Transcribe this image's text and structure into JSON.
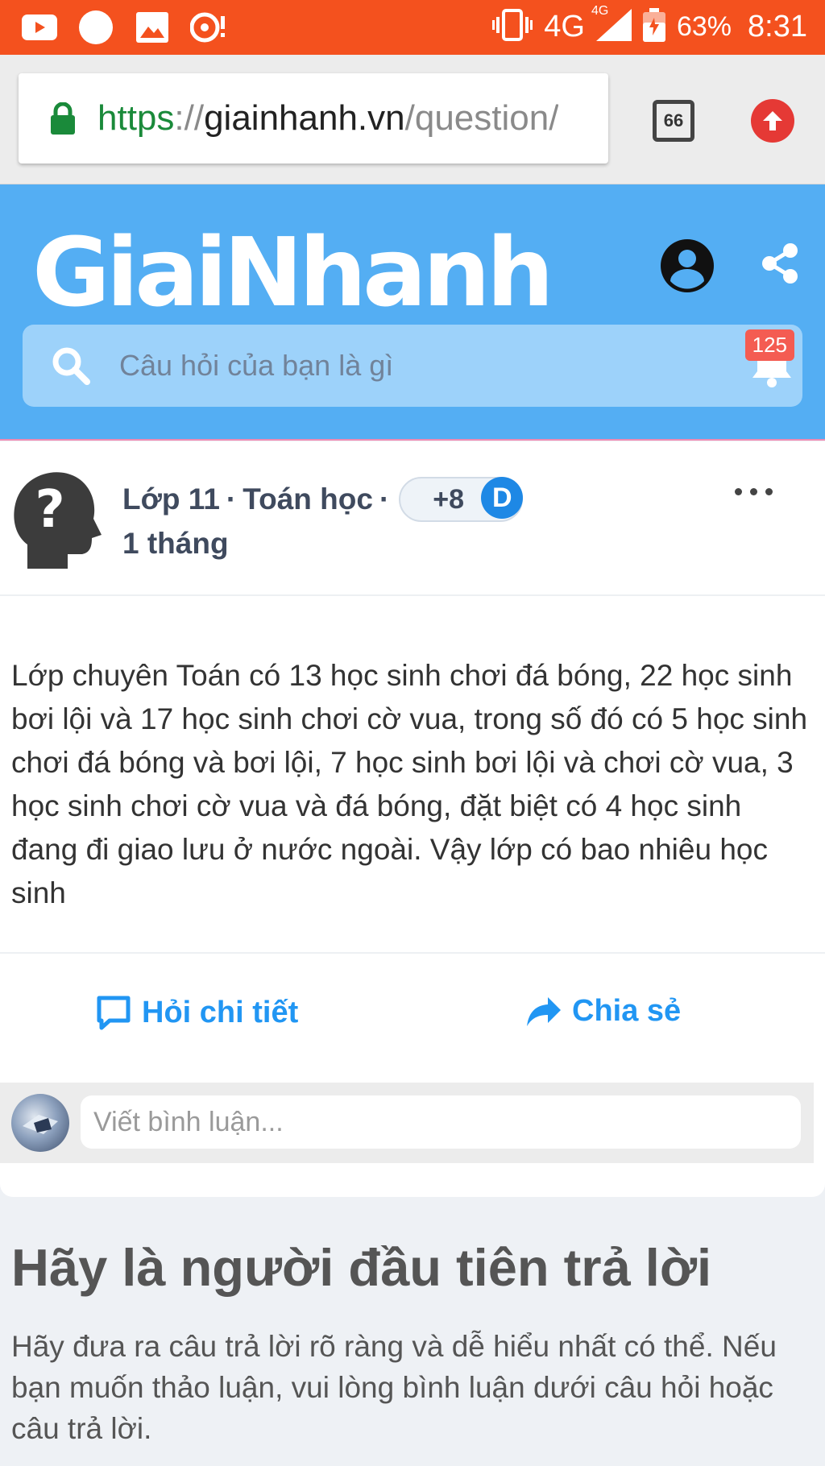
{
  "status_bar": {
    "icons_left": [
      "youtube-icon",
      "circle-icon",
      "image-icon",
      "cast-icon"
    ],
    "network": "4G",
    "network_small": "4G",
    "battery_percent": "63%",
    "time": "8:31",
    "bg_color": "#f4511e"
  },
  "browser": {
    "url_scheme": "https",
    "url_sep": "://",
    "url_host": "giainhanh.vn",
    "url_path": "/question/",
    "tab_count": "66",
    "upload_color": "#e53935"
  },
  "header": {
    "logo": "GiaiNhanh",
    "search_placeholder": "Câu hỏi của bạn là gì",
    "notification_count": "125",
    "bg_color": "#54aef3"
  },
  "question": {
    "grade": "Lớp 11",
    "subject": "Toán học",
    "points": "+8",
    "points_badge": "D",
    "time": "1 tháng",
    "text": "Lớp chuyên Toán có 13 học sinh chơi đá bóng, 22 học sinh bơi lội và 17 học sinh chơi cờ vua, trong số đó có 5 học sinh chơi đá bóng và bơi lội, 7 học sinh bơi lội và chơi cờ vua, 3 học sinh chơi cờ vua và đá bóng, đặt biệt có 4 học sinh đang đi giao lưu ở nước ngoài. Vậy lớp có bao nhiêu học sinh",
    "ask_detail_label": "Hỏi chi tiết",
    "share_label": "Chia sẻ",
    "comment_placeholder": "Viết bình luận...",
    "accent_color": "#2196f3"
  },
  "answer_prompt": {
    "title": "Hãy là người đầu tiên trả lời",
    "description": "Hãy đưa ra câu trả lời rõ ràng và dễ hiểu nhất có thể. Nếu bạn muốn thảo luận, vui lòng bình luận dưới câu hỏi hoặc câu trả lời."
  }
}
